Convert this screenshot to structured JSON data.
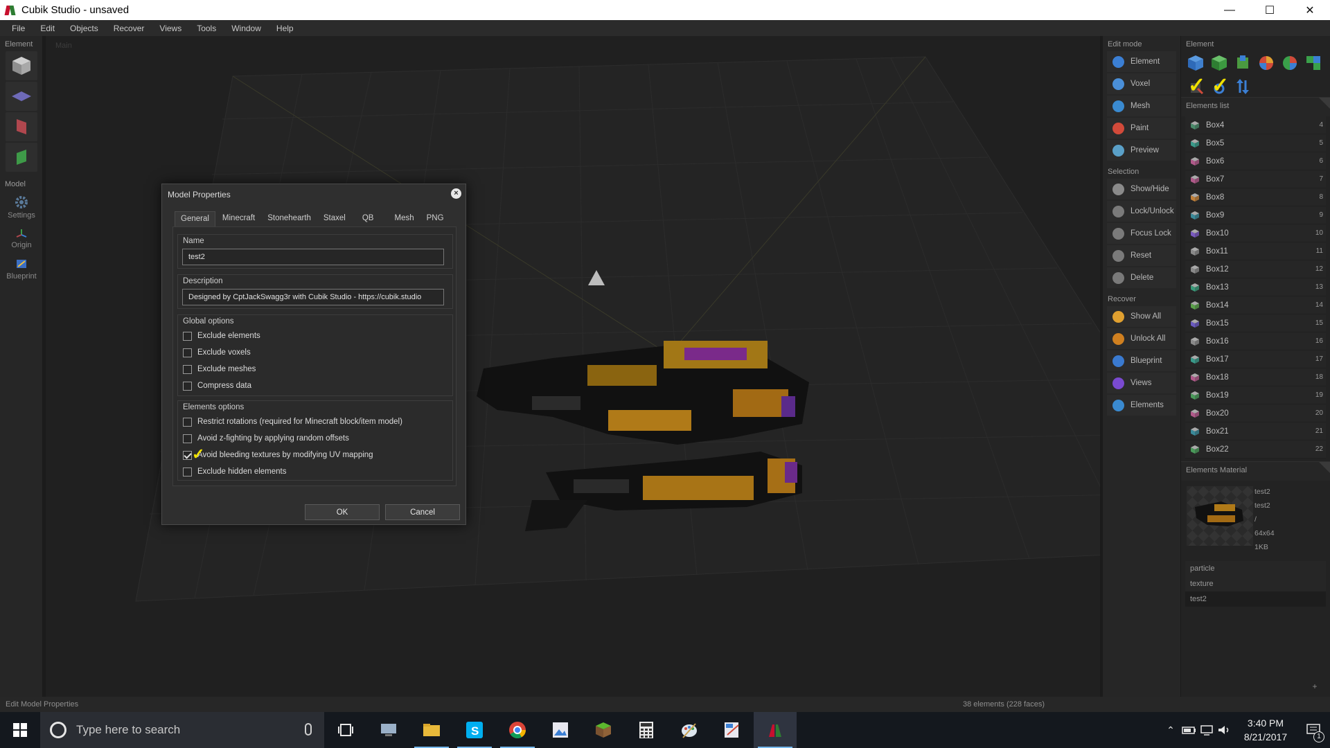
{
  "window": {
    "title": "Cubik Studio - unsaved",
    "controls": [
      "minimize-icon",
      "maximize-icon",
      "close-icon"
    ]
  },
  "menu": [
    "File",
    "Edit",
    "Objects",
    "Recover",
    "Views",
    "Tools",
    "Window",
    "Help"
  ],
  "left_panel": {
    "element_label": "Element",
    "model_label": "Model",
    "model_tools": [
      {
        "label": "Settings",
        "icon": "gear-icon"
      },
      {
        "label": "Origin",
        "icon": "origin-icon"
      },
      {
        "label": "Blueprint",
        "icon": "blueprint-icon"
      }
    ]
  },
  "viewport": {
    "label": "Main"
  },
  "dialog": {
    "title": "Model Properties",
    "tabs": [
      "General",
      "Minecraft",
      "Stonehearth",
      "Staxel",
      "QB",
      "Mesh",
      "PNG"
    ],
    "name_label": "Name",
    "name_value": "test2",
    "description_label": "Description",
    "description_value": "Designed by CptJackSwagg3r with Cubik Studio - https://cubik.studio",
    "global_label": "Global options",
    "global_options": [
      {
        "label": "Exclude elements",
        "checked": false
      },
      {
        "label": "Exclude voxels",
        "checked": false
      },
      {
        "label": "Exclude meshes",
        "checked": false
      },
      {
        "label": "Compress data",
        "checked": false
      }
    ],
    "elements_label": "Elements options",
    "element_options": [
      {
        "label": "Restrict rotations (required for Minecraft block/item model)",
        "checked": false
      },
      {
        "label": "Avoid z-fighting by applying random offsets",
        "checked": false
      },
      {
        "label": "Avoid bleeding textures by modifying UV mapping",
        "checked": true
      },
      {
        "label": "Exclude hidden elements",
        "checked": false
      }
    ],
    "ok_label": "OK",
    "cancel_label": "Cancel"
  },
  "edit_mode": {
    "label": "Edit mode",
    "modes": [
      {
        "label": "Element",
        "color": "#3b7fd4"
      },
      {
        "label": "Voxel",
        "color": "#4a8fd8"
      },
      {
        "label": "Mesh",
        "color": "#3a8ad0"
      },
      {
        "label": "Paint",
        "color": "#d24a3a"
      },
      {
        "label": "Preview",
        "color": "#5aa0c8"
      }
    ],
    "selection_label": "Selection",
    "selection": [
      {
        "label": "Show/Hide",
        "color": "#8a8a8a"
      },
      {
        "label": "Lock/Unlock",
        "color": "#7a7a7a"
      },
      {
        "label": "Focus Lock",
        "color": "#7a7a7a"
      },
      {
        "label": "Reset",
        "color": "#7a7a7a"
      },
      {
        "label": "Delete",
        "color": "#7a7a7a"
      }
    ],
    "recover_label": "Recover",
    "recover": [
      {
        "label": "Show All",
        "color": "#e0a030"
      },
      {
        "label": "Unlock All",
        "color": "#d08020"
      },
      {
        "label": "Blueprint",
        "color": "#3a7ad0"
      },
      {
        "label": "Views",
        "color": "#7a4ad0"
      },
      {
        "label": "Elements",
        "color": "#3a8ad0"
      }
    ]
  },
  "element_panel": {
    "label": "Element",
    "list_label": "Elements list",
    "elements": [
      {
        "name": "Box4",
        "num": "4",
        "color": "#4a8a6a"
      },
      {
        "name": "Box5",
        "num": "5",
        "color": "#3a9a8a"
      },
      {
        "name": "Box6",
        "num": "6",
        "color": "#b05a8a"
      },
      {
        "name": "Box7",
        "num": "7",
        "color": "#b05a8a"
      },
      {
        "name": "Box8",
        "num": "8",
        "color": "#c0803a"
      },
      {
        "name": "Box9",
        "num": "9",
        "color": "#3a8a9a"
      },
      {
        "name": "Box10",
        "num": "10",
        "color": "#7a5ac0"
      },
      {
        "name": "Box11",
        "num": "11",
        "color": "#8a8a8a"
      },
      {
        "name": "Box12",
        "num": "12",
        "color": "#8a8a8a"
      },
      {
        "name": "Box13",
        "num": "13",
        "color": "#3a9a7a"
      },
      {
        "name": "Box14",
        "num": "14",
        "color": "#5aa04a"
      },
      {
        "name": "Box15",
        "num": "15",
        "color": "#6a5ac0"
      },
      {
        "name": "Box16",
        "num": "16",
        "color": "#8a8a8a"
      },
      {
        "name": "Box17",
        "num": "17",
        "color": "#3a9a8a"
      },
      {
        "name": "Box18",
        "num": "18",
        "color": "#b05a8a"
      },
      {
        "name": "Box19",
        "num": "19",
        "color": "#4a9a5a"
      },
      {
        "name": "Box20",
        "num": "20",
        "color": "#b05a8a"
      },
      {
        "name": "Box21",
        "num": "21",
        "color": "#3a8a9a"
      },
      {
        "name": "Box22",
        "num": "22",
        "color": "#4a9a5a"
      }
    ],
    "material_label": "Elements Material",
    "material_info": [
      "test2",
      "test2",
      "/",
      "64x64",
      "1KB"
    ],
    "materials": [
      "particle",
      "texture",
      "test2"
    ]
  },
  "status": {
    "left": "Edit Model Properties",
    "right": "38 elements (228 faces)"
  },
  "taskbar": {
    "search_placeholder": "Type here to search",
    "time": "3:40 PM",
    "date": "8/21/2017",
    "notification_count": "1"
  }
}
